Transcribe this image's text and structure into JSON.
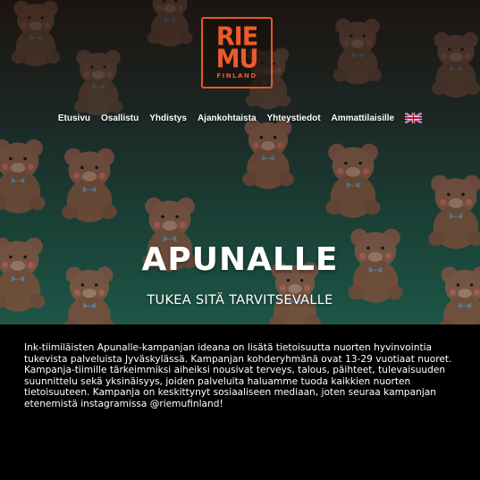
{
  "logo": {
    "line1": "RIE",
    "line2": "MU",
    "line3": "FINLAND"
  },
  "nav": {
    "items": [
      {
        "label": "Etusivu"
      },
      {
        "label": "Osallistu"
      },
      {
        "label": "Yhdistys"
      },
      {
        "label": "Ajankohtaista"
      },
      {
        "label": "Yhteystiedot"
      },
      {
        "label": "Ammattilaisille"
      }
    ],
    "language_icon": "uk-flag-icon"
  },
  "hero": {
    "title": "APUNALLE",
    "subtitle": "TUKEA SITÄ TARVITSEVALLE"
  },
  "content": {
    "paragraph": "Ink-tiimiläisten Apunalle-kampanjan ideana on lisätä tietoisuutta nuorten hyvinvointia tukevista palveluista Jyväskylässä. Kampanjan kohderyhmänä ovat 13-29 vuotiaat nuoret. Kampanja-tiimille tärkeimmiksi aiheiksi nousivat terveys, talous, päihteet, tulevaisuuden suunnittelu sekä yksinäisyys, joiden palveluita haluamme tuoda kaikkien nuorten tietoisuuteen. Kampanja on keskittynyt sosiaaliseen mediaan, joten seuraa kampanjan etenemistä instagramissa @riemufinland!"
  },
  "colors": {
    "brand": "#ef5a2a",
    "background": "#000000",
    "hero_green": "#1f5a4a"
  }
}
